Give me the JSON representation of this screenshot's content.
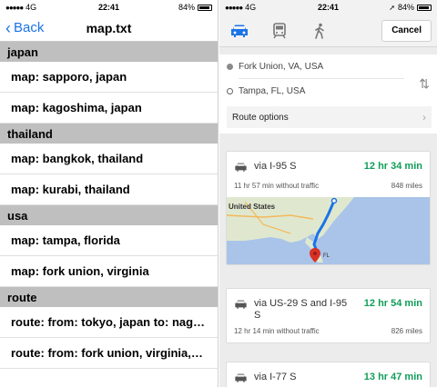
{
  "left": {
    "status": {
      "carrier_signal": "●●●●●",
      "network": "4G",
      "time": "22:41",
      "battery_pct": "84%"
    },
    "nav": {
      "back_label": "Back",
      "title": "map.txt"
    },
    "sections": [
      {
        "header": "japan",
        "rows": [
          "map: sapporo, japan",
          "map: kagoshima, japan"
        ]
      },
      {
        "header": "thailand",
        "rows": [
          "map: bangkok, thailand",
          "map: kurabi, thailand"
        ]
      },
      {
        "header": "usa",
        "rows": [
          "map: tampa, florida",
          "map: fork union, virginia"
        ]
      },
      {
        "header": "route",
        "rows": [
          "route: from: tokyo, japan to: nag…",
          "route: from: fork union, virginia,…"
        ]
      }
    ]
  },
  "right": {
    "status": {
      "carrier_signal": "●●●●●",
      "network": "4G",
      "time": "22:41",
      "battery_pct": "84%"
    },
    "modes": [
      {
        "icon": "car-icon",
        "selected": true
      },
      {
        "icon": "transit-icon",
        "selected": false
      },
      {
        "icon": "walk-icon",
        "selected": false
      }
    ],
    "cancel_label": "Cancel",
    "origin": "Fork Union, VA, USA",
    "destination": "Tampa, FL, USA",
    "route_options_label": "Route options",
    "routes": [
      {
        "via": "via I-95 S",
        "duration": "12 hr 34 min",
        "traffic_note": "11 hr 57 min without traffic",
        "distance": "848 miles"
      },
      {
        "via": "via US-29 S and I-95 S",
        "duration": "12 hr 54 min",
        "traffic_note": "12 hr 14 min without traffic",
        "distance": "826 miles"
      },
      {
        "via": "via I-77 S",
        "duration": "13 hr 47 min"
      }
    ],
    "map_labels": {
      "country": "United States",
      "fl_label": "FL"
    },
    "colors": {
      "accent_blue": "#1a73e8",
      "duration_green": "#0f9d58",
      "section_gray": "#bfbfbf"
    }
  }
}
